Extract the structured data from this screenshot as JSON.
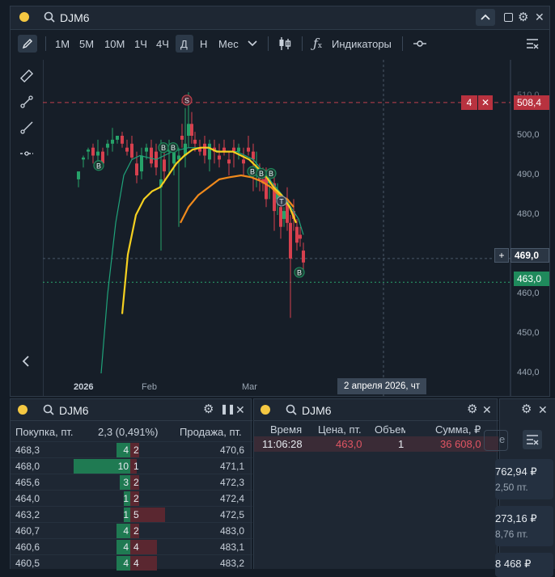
{
  "chart_window": {
    "ticker": "DJM6",
    "timeframes": [
      "1М",
      "5М",
      "10М",
      "1Ч",
      "4Ч",
      "Д",
      "Н",
      "Мес"
    ],
    "active_timeframe": "Д",
    "indicators_label": "Индикаторы",
    "y_ticks": [
      "510,0",
      "500,0",
      "490,0",
      "480,0",
      "470,0",
      "460,0",
      "450,0",
      "440,0"
    ],
    "x_labels": [
      "2026",
      "Feb",
      "Mar"
    ],
    "crosshair_date": "2 апреля 2026, чт",
    "crosshair_price": "469,0",
    "order_qty": "4",
    "order_price": "508,4",
    "last_price": "463,0",
    "signal_markers": [
      "B",
      "B",
      "S",
      "B",
      "B",
      "T",
      "B"
    ]
  },
  "orderbook": {
    "ticker": "DJM6",
    "buy_header": "Покупка, пт.",
    "spread": "2,3 (0,491%)",
    "sell_header": "Продажа, пт.",
    "rows": [
      {
        "bid": "468,3",
        "bid_qty": "4",
        "ask_qty": "2",
        "ask": "470,6",
        "bid_frac": 0.24,
        "ask_frac": 0.12
      },
      {
        "bid": "468,0",
        "bid_qty": "10",
        "ask_qty": "1",
        "ask": "471,1",
        "bid_frac": 1.0,
        "ask_frac": 0.06
      },
      {
        "bid": "465,6",
        "bid_qty": "3",
        "ask_qty": "2",
        "ask": "472,3",
        "bid_frac": 0.18,
        "ask_frac": 0.12
      },
      {
        "bid": "464,0",
        "bid_qty": "1",
        "ask_qty": "2",
        "ask": "472,4",
        "bid_frac": 0.06,
        "ask_frac": 0.12
      },
      {
        "bid": "463,2",
        "bid_qty": "1",
        "ask_qty": "5",
        "ask": "472,5",
        "bid_frac": 0.06,
        "ask_frac": 0.45
      },
      {
        "bid": "460,7",
        "bid_qty": "4",
        "ask_qty": "2",
        "ask": "483,0",
        "bid_frac": 0.24,
        "ask_frac": 0.12
      },
      {
        "bid": "460,6",
        "bid_qty": "4",
        "ask_qty": "4",
        "ask": "483,1",
        "bid_frac": 0.24,
        "ask_frac": 0.35
      },
      {
        "bid": "460,5",
        "bid_qty": "4",
        "ask_qty": "4",
        "ask": "483,2",
        "bid_frac": 0.24,
        "ask_frac": 0.35
      }
    ]
  },
  "trades": {
    "ticker": "DJM6",
    "headers": [
      "Время",
      "Цена, пт.",
      "Объем",
      "Сумма, ₽"
    ],
    "rows": [
      {
        "time": "11:06:28",
        "price": "463,0",
        "volume": "1",
        "sum": "36 608,0"
      }
    ]
  },
  "side_panel": {
    "items": [
      {
        "value": "762,94 ₽",
        "sub": "2,50 пт."
      },
      {
        "value": "273,16 ₽",
        "sub": "8,76 пт."
      },
      {
        "value": "8 468 ₽",
        "sub": ""
      }
    ]
  },
  "colors": {
    "up": "#26a269",
    "down": "#d6404e",
    "ma_fast": "#1fa37a",
    "ma_mid": "#f5d020",
    "ma_slow": "#f08a1c",
    "accent": "#f5c842"
  }
}
